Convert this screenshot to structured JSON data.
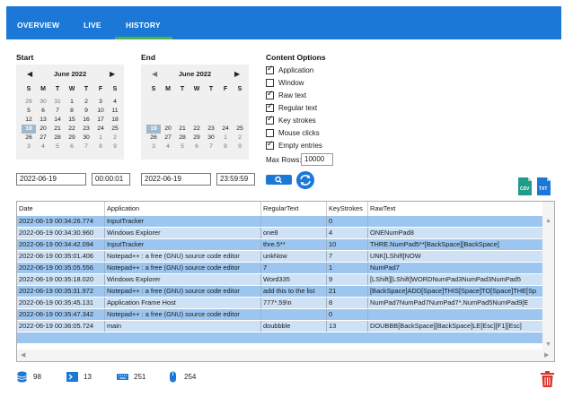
{
  "tabs": [
    {
      "label": "OVERVIEW"
    },
    {
      "label": "LIVE"
    },
    {
      "label": "HISTORY"
    }
  ],
  "active_tab": "HISTORY",
  "accent_color": "#1c78d6",
  "tab_underline_color": "#4caf50",
  "start": {
    "label": "Start",
    "month": "June 2022",
    "days_of_week": [
      "S",
      "M",
      "T",
      "W",
      "T",
      "F",
      "S"
    ],
    "selected_day": "19",
    "date": "2022-06-19",
    "time": "00:00:01"
  },
  "end": {
    "label": "End",
    "month": "June 2022",
    "days_of_week": [
      "S",
      "M",
      "T",
      "W",
      "T",
      "F",
      "S"
    ],
    "selected_day": "19",
    "date": "2022-06-19",
    "time": "23:59:59"
  },
  "content_options": {
    "label": "Content Options",
    "items": [
      {
        "label": "Application",
        "checked": true
      },
      {
        "label": "Window",
        "checked": false
      },
      {
        "label": "Raw text",
        "checked": true
      },
      {
        "label": "Regular text",
        "checked": true
      },
      {
        "label": "Key strokes",
        "checked": true
      },
      {
        "label": "Mouse clicks",
        "checked": false
      },
      {
        "label": "Empty entries",
        "checked": true
      }
    ],
    "max_rows_label": "Max Rows:",
    "max_rows": "10000"
  },
  "export": {
    "csv_label": "CSV",
    "txt_label": "TXT"
  },
  "table": {
    "columns": [
      "Date",
      "Application",
      "RegularText",
      "KeyStrokes",
      "RawText"
    ],
    "rows": [
      [
        "2022-06-19 00:34:26.774",
        "InputTracker",
        "",
        "0",
        ""
      ],
      [
        "2022-06-19 00:34:30.960",
        "Windows Explorer",
        "one8",
        "4",
        "ONENumPad8"
      ],
      [
        "2022-06-19 00:34:42.094",
        "InputTracker",
        "thre.5**",
        "10",
        "THRE.NumPad5**[BackSpace][BackSpace]"
      ],
      [
        "2022-06-19 00:35:01.406",
        "Notepad++ : a free (GNU) source code editor",
        "unkNow",
        "7",
        "UNK[LShift]NOW"
      ],
      [
        "2022-06-19 00:35:05.556",
        "Notepad++ : a free (GNU) source code editor",
        "7",
        "1",
        "NumPad7"
      ],
      [
        "2022-06-19 00:35:18.020",
        "Windows Explorer",
        "Word335",
        "9",
        "[LShift][LShift]WORDNumPad3NumPad3NumPad5"
      ],
      [
        "2022-06-19 00:35:31.972",
        "Notepad++ : a free (GNU) source code editor",
        "add this to the list",
        "21",
        "[BackSpace]ADD[Space]THIS[Space]TO[Space]THE[Sp"
      ],
      [
        "2022-06-19 00:35:45.131",
        "Application Frame Host",
        "777*.59\\n",
        "8",
        "NumPad7NumPad7NumPad7*.NumPad5NumPad9[E"
      ],
      [
        "2022-06-19 00:35:47.342",
        "Notepad++ : a free (GNU) source code editor",
        "",
        "0",
        ""
      ],
      [
        "2022-06-19 00:36:05.724",
        "main",
        "doubbble",
        "13",
        "DOUBBB[BackSpace][BackSpace]LE[Esc][F1][Esc]"
      ]
    ]
  },
  "stats": {
    "entries": "98",
    "apps": "13",
    "keystrokes": "251",
    "clicks": "254"
  }
}
